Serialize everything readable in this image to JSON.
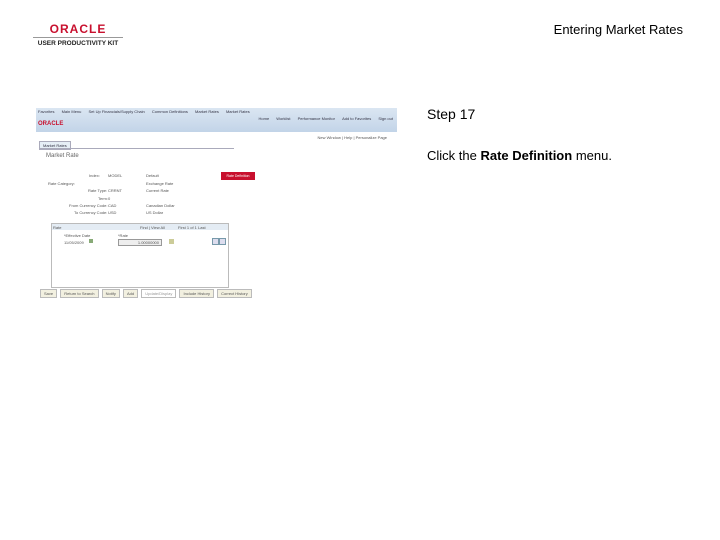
{
  "header": {
    "logo_main": "ORACLE",
    "logo_sub": "USER PRODUCTIVITY KIT",
    "title": "Entering Market Rates"
  },
  "app": {
    "breadcrumb": [
      "Favorites",
      "Main Menu",
      "Set Up Financials/Supply Chain",
      "Common Definitions",
      "Market Rates",
      "Market Rates"
    ],
    "top_links": [
      "Home",
      "Worklist",
      "Performance Monitor",
      "Add to Favorites",
      "Sign out"
    ],
    "logo": "ORACLE",
    "page_links": "New Window | Help | Personalize Page",
    "tab": "Market Rates",
    "page_title": "Market Rate",
    "index_label": "Index:",
    "index_value": "MODEL",
    "index_desc": "Default",
    "rate_category_label": "Rate Category:",
    "rate_category_value": "Exchange Rate",
    "rate_type_label": "Rate Type:",
    "rate_type_value": "CRRNT",
    "rate_type_desc": "Current Rate",
    "term_label": "Term:",
    "term_value": "0",
    "from_label": "From Currency Code:",
    "from_value": "CAD",
    "from_desc": "Canadian Dollar",
    "to_label": "To Currency Code:",
    "to_value": "USD",
    "to_desc": "US Dollar",
    "rate_definition_button": "Rate Definition",
    "grid": {
      "title": "Rate",
      "find": "Find | View All",
      "nav": "First 1 of 1 Last",
      "col_date": "*Effective Date",
      "col_rate": "*Rate",
      "date_value": "11/05/2009",
      "rate_value": "1.00000000"
    },
    "buttons": [
      "Save",
      "Return to Search",
      "Notify",
      "Add",
      "Update/Display",
      "Include History",
      "Correct History"
    ]
  },
  "step": {
    "label": "Step 17",
    "instruction_pre": "Click the ",
    "instruction_bold": "Rate Definition",
    "instruction_post": " menu."
  }
}
